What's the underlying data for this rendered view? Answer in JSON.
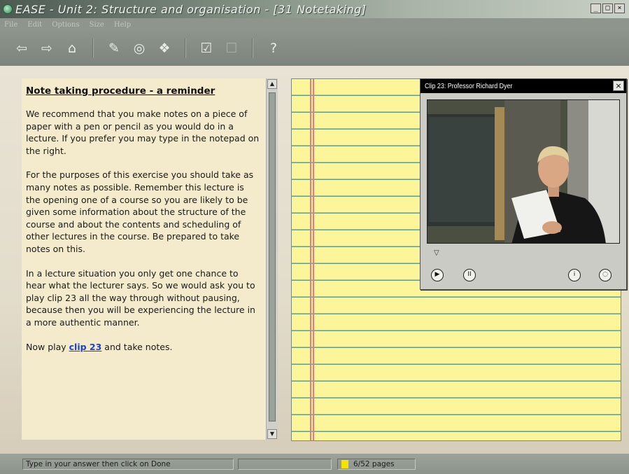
{
  "window": {
    "title": "EASE - Unit 2: Structure and organisation - [31 Notetaking]",
    "controls": [
      "_",
      "□",
      "×"
    ]
  },
  "menu": [
    "File",
    "Edit",
    "Options",
    "Size",
    "Help"
  ],
  "toolbar": {
    "buttons": [
      {
        "name": "back-arrow-icon",
        "glyph": "⇦"
      },
      {
        "name": "forward-arrow-icon",
        "glyph": "⇨"
      },
      {
        "name": "home-icon",
        "glyph": "⌂"
      },
      {
        "name": "notes-icon",
        "glyph": "✎"
      },
      {
        "name": "glossary-icon",
        "glyph": "◎"
      },
      {
        "name": "resources-icon",
        "glyph": "❖"
      },
      {
        "name": "done-check-icon",
        "glyph": "☑"
      },
      {
        "name": "cancel-icon",
        "glyph": "☐"
      },
      {
        "name": "help-icon",
        "glyph": "?"
      }
    ]
  },
  "instructions": {
    "heading": "Note taking procedure - a reminder",
    "para1": "We recommend that you make notes on a piece of paper with a pen or pencil as you would do in a lecture.  If you prefer you may type in the notepad on the right.",
    "para2": "For the purposes of this exercise you should take as many notes as possible. Remember this lecture is the opening one of a course so you are likely to be given some information about the structure of the course and about the contents and scheduling of other lectures in the course. Be prepared to take notes on this.",
    "para3": "In a lecture situation you only get one chance to hear what the lecturer says.  So we would ask you to play clip 23 all the way through without pausing, because then you will be experiencing the lecture in a more authentic manner.",
    "para4_prefix": "Now play ",
    "para4_link": "clip 23",
    "para4_suffix": " and take notes."
  },
  "video": {
    "title": "Clip 23: Professor Richard Dyer",
    "close_glyph": "×",
    "controls": {
      "play": "▶",
      "pause": "II",
      "info": "i",
      "extra": "◌"
    }
  },
  "status": {
    "message": "Type in your answer then click on Done",
    "pages": "6/52 pages"
  },
  "colors": {
    "notepad": "#fdf59a",
    "notepad_rule": "#5f9f8a",
    "margin_rule": "#e57a80",
    "instruction_bg": "#f3ebcb",
    "link": "#1a3fd6",
    "page_indicator": "#f5e400"
  }
}
